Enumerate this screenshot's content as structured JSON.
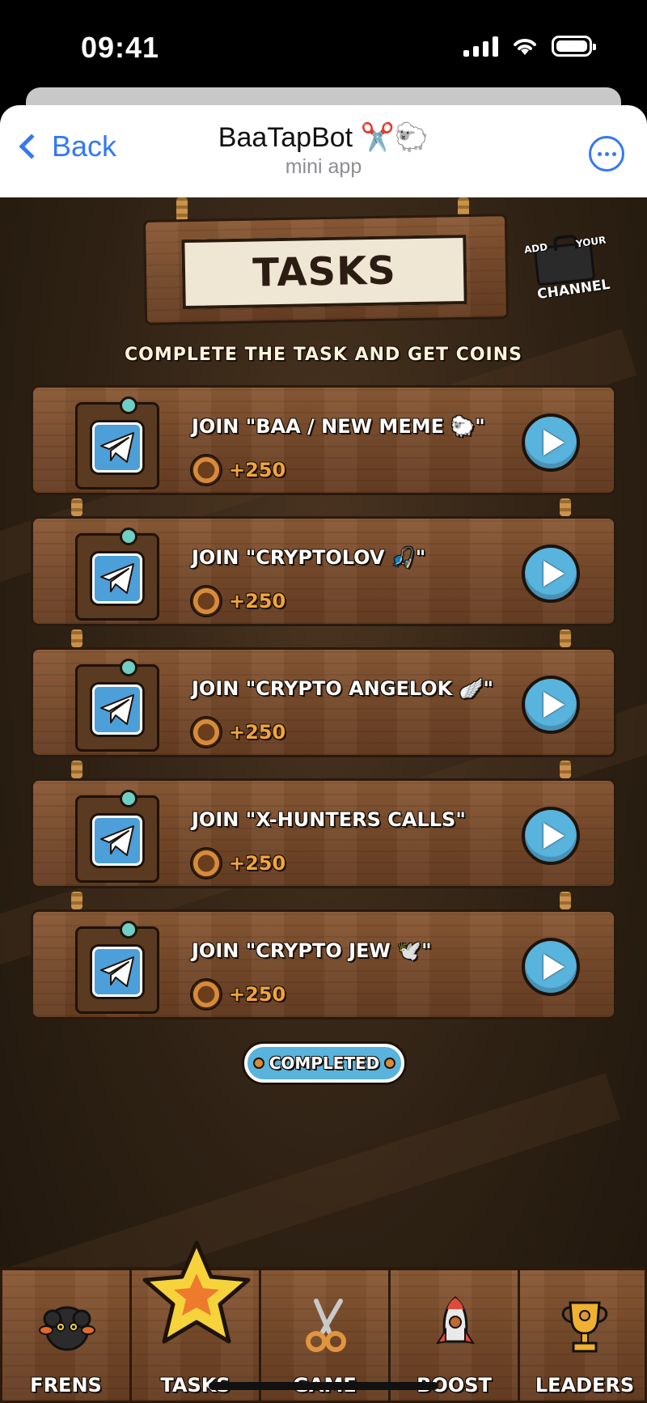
{
  "status_bar": {
    "time": "09:41"
  },
  "header": {
    "back_label": "Back",
    "title": "BaaTapBot ✂️🐑",
    "subtitle": "mini app"
  },
  "page": {
    "title": "TASKS",
    "subtitle": "COMPLETE THE TASK AND GET COINS",
    "channel_badge": {
      "add": "ADD",
      "your": "YOUR",
      "channel": "CHANNEL"
    },
    "completed_label": "COMPLETED"
  },
  "tasks": [
    {
      "title": "JOIN \"BAA / NEW MEME 🐑\"",
      "reward": "+250"
    },
    {
      "title": "JOIN \"CRYPTOLOV 🎣\"",
      "reward": "+250"
    },
    {
      "title": "JOIN \"CRYPTO ANGELOK 🪽\"",
      "reward": "+250"
    },
    {
      "title": "JOIN \"X-HUNTERS CALLS\"",
      "reward": "+250"
    },
    {
      "title": "JOIN \"CRYPTO JEW 🕊️\"",
      "reward": "+250"
    }
  ],
  "nav": [
    {
      "label": "FRENS",
      "icon": "sheep-icon"
    },
    {
      "label": "TASKS",
      "icon": "star-icon",
      "active": true
    },
    {
      "label": "GAME",
      "icon": "scissors-icon"
    },
    {
      "label": "BOOST",
      "icon": "rocket-icon"
    },
    {
      "label": "LEADERS",
      "icon": "trophy-icon"
    }
  ],
  "colors": {
    "accent_blue": "#3478f6",
    "play_blue": "#58b3dd",
    "wood": "#764a2b",
    "coin_orange": "#f3a43a"
  }
}
